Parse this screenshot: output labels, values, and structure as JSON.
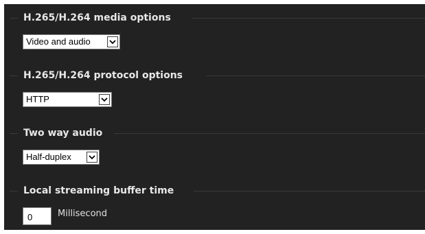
{
  "sections": [
    {
      "title": "H.265/H.264 media options",
      "selected": "Video and audio"
    },
    {
      "title": "H.265/H.264 protocol options",
      "selected": "HTTP"
    },
    {
      "title": "Two way audio",
      "selected": "Half-duplex"
    },
    {
      "title": "Local streaming buffer time",
      "value": "0",
      "unit": "Millisecond"
    }
  ],
  "icons": {
    "dropdown": "chevron-down-icon"
  }
}
